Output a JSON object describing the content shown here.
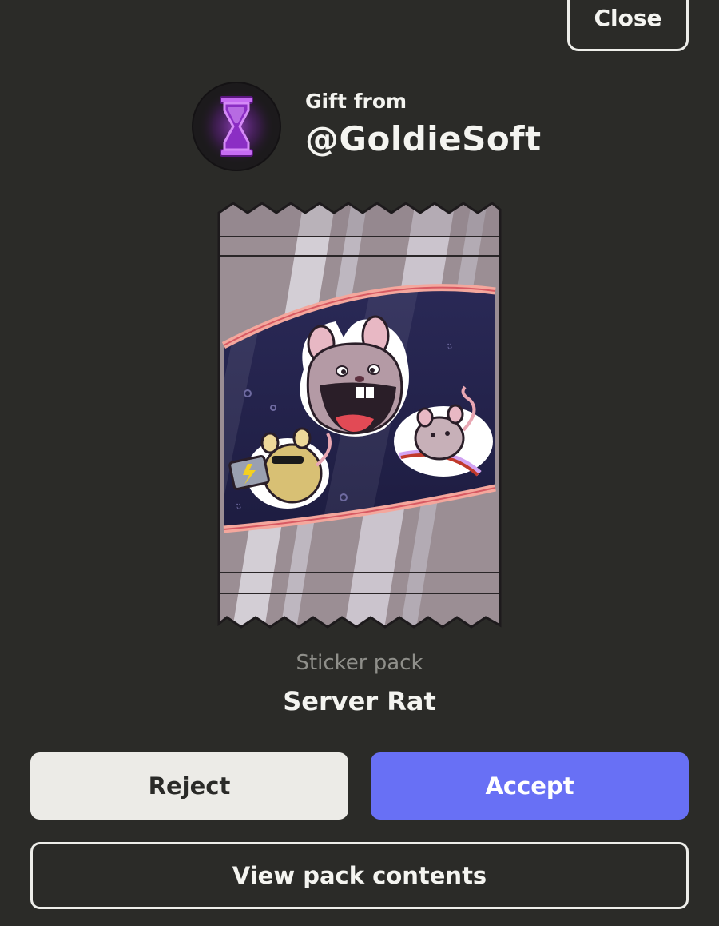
{
  "header": {
    "close_label": "Close"
  },
  "gift": {
    "from_label": "Gift from",
    "sender": "@GoldieSoft",
    "avatar_icon": "hourglass-icon"
  },
  "pack": {
    "type_label": "Sticker pack",
    "name": "Server Rat"
  },
  "actions": {
    "reject_label": "Reject",
    "accept_label": "Accept",
    "view_contents_label": "View pack contents"
  },
  "colors": {
    "background": "#2b2b28",
    "accent": "#6870f5",
    "reject_bg": "#ecebe7",
    "muted_text": "#8f8f8a"
  }
}
